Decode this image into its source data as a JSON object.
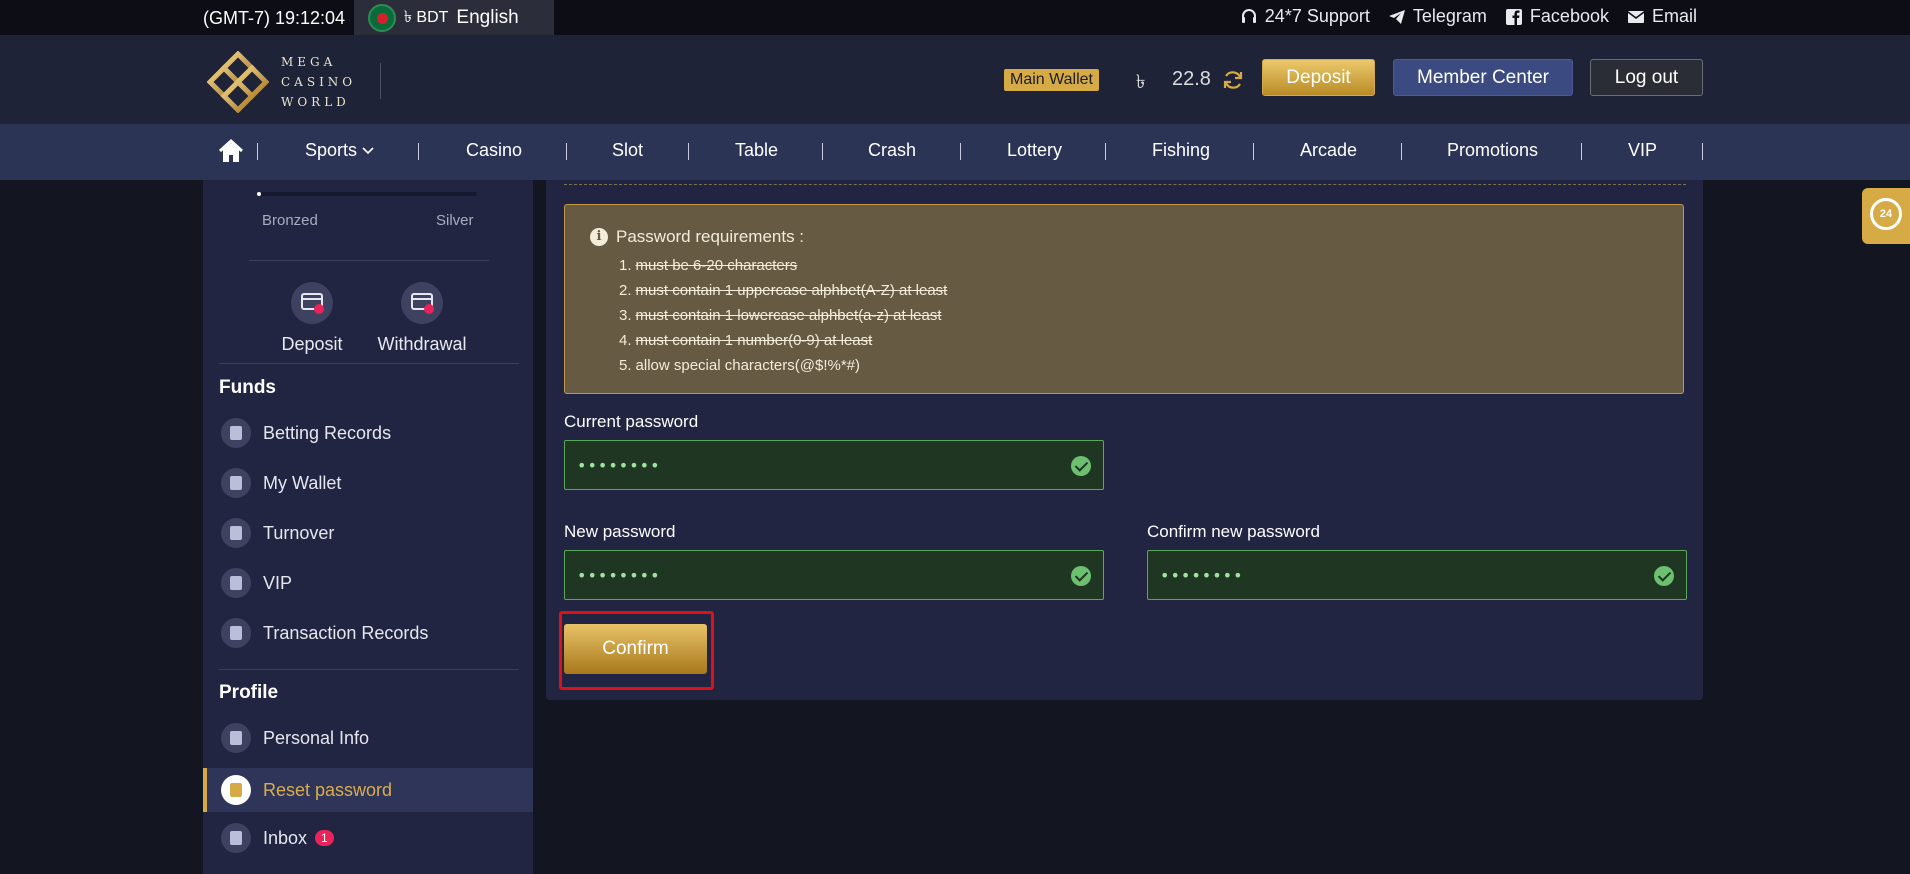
{
  "topbar": {
    "time": "(GMT-7) 19:12:04",
    "currency": "৳ BDT",
    "language": "English",
    "links": [
      {
        "label": "24*7 Support",
        "icon": "headset-icon"
      },
      {
        "label": "Telegram",
        "icon": "telegram-icon"
      },
      {
        "label": "Facebook",
        "icon": "facebook-icon"
      },
      {
        "label": "Email",
        "icon": "email-icon"
      }
    ]
  },
  "header": {
    "logo_lines": [
      "MEGA",
      "CASINO",
      "WORLD"
    ],
    "wallet_label": "Main Wallet",
    "wallet_currency": "৳",
    "wallet_amount": "22.8",
    "deposit_label": "Deposit",
    "member_center_label": "Member Center",
    "logout_label": "Log out",
    "accent_color": "#d6ab46"
  },
  "nav": {
    "items": [
      "Sports",
      "Casino",
      "Slot",
      "Table",
      "Crash",
      "Lottery",
      "Fishing",
      "Arcade",
      "Promotions",
      "VIP"
    ]
  },
  "sidebar": {
    "level_from": "Bronzed",
    "level_to": "Silver",
    "level_progress": 0.01,
    "quick_actions": [
      "Deposit",
      "Withdrawal"
    ],
    "funds_title": "Funds",
    "funds_items": [
      "Betting Records",
      "My Wallet",
      "Turnover",
      "VIP",
      "Transaction Records"
    ],
    "profile_title": "Profile",
    "profile_items": [
      "Personal Info",
      "Reset password",
      "Inbox"
    ],
    "inbox_badge": "1",
    "active_item": "Reset password"
  },
  "form": {
    "requirements_title": "Password requirements :",
    "requirements": [
      {
        "num": "1.",
        "text": "must be 6-20 characters",
        "done": true
      },
      {
        "num": "2.",
        "text": "must contain 1 uppercase alphbet(A-Z) at least",
        "done": true
      },
      {
        "num": "3.",
        "text": "must contain 1 lowercase alphbet(a-z) at least",
        "done": true
      },
      {
        "num": "4.",
        "text": "must contain 1 number(0-9) at least",
        "done": true
      },
      {
        "num": "5.",
        "text": "allow special characters(@$!%*#)",
        "done": false
      }
    ],
    "current_password_label": "Current password",
    "current_password_value": "••••••••",
    "new_password_label": "New password",
    "new_password_value": "••••••••",
    "confirm_password_label": "Confirm new password",
    "confirm_password_value": "••••••••",
    "confirm_label": "Confirm"
  },
  "float_support": {
    "label": "24"
  }
}
